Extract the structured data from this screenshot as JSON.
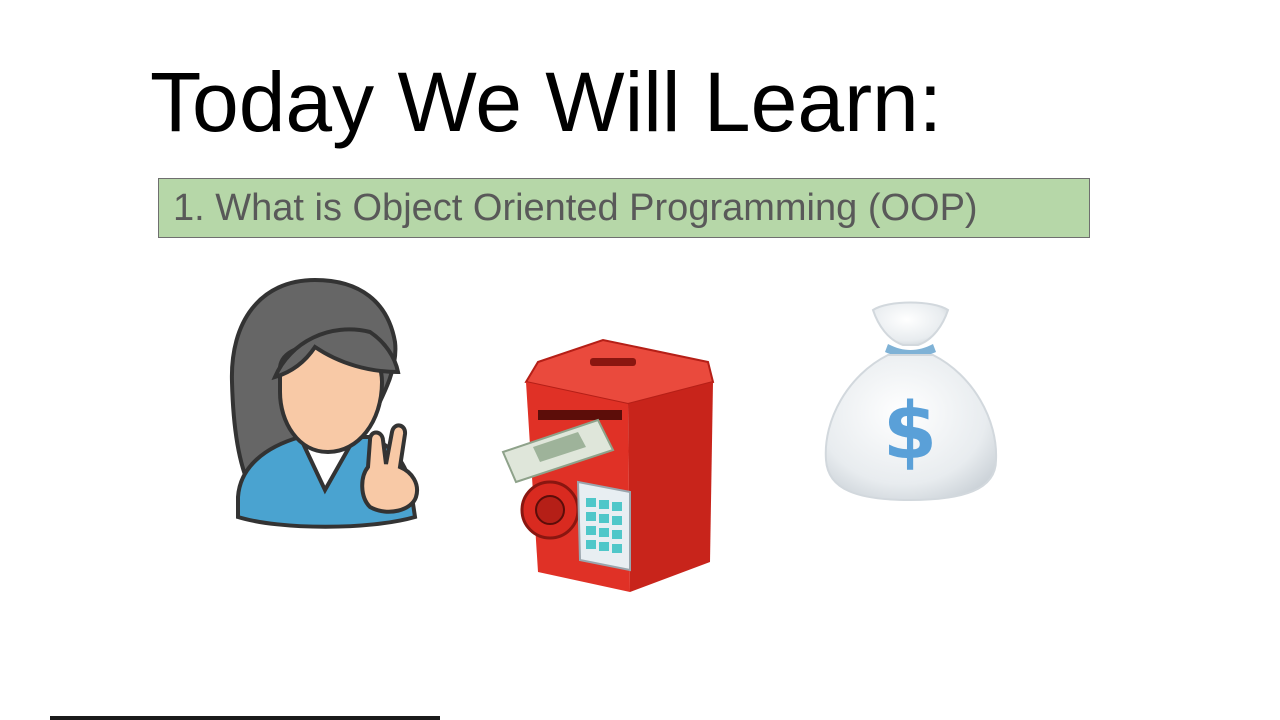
{
  "slide": {
    "title": "Today We Will Learn:",
    "points": [
      {
        "label": "1. What is Object Oriented Programming (OOP)"
      }
    ]
  },
  "illustrations": [
    {
      "icon": "person-peace-sign-icon"
    },
    {
      "icon": "piggy-bank-safe-icon"
    },
    {
      "icon": "money-bag-icon"
    }
  ],
  "colors": {
    "point_background": "#b6d7a8",
    "point_text": "#595959",
    "title_text": "#000000",
    "safe_red": "#e03126",
    "bag_dollar": "#5aa0d8",
    "shirt_blue": "#4aa3d0"
  }
}
